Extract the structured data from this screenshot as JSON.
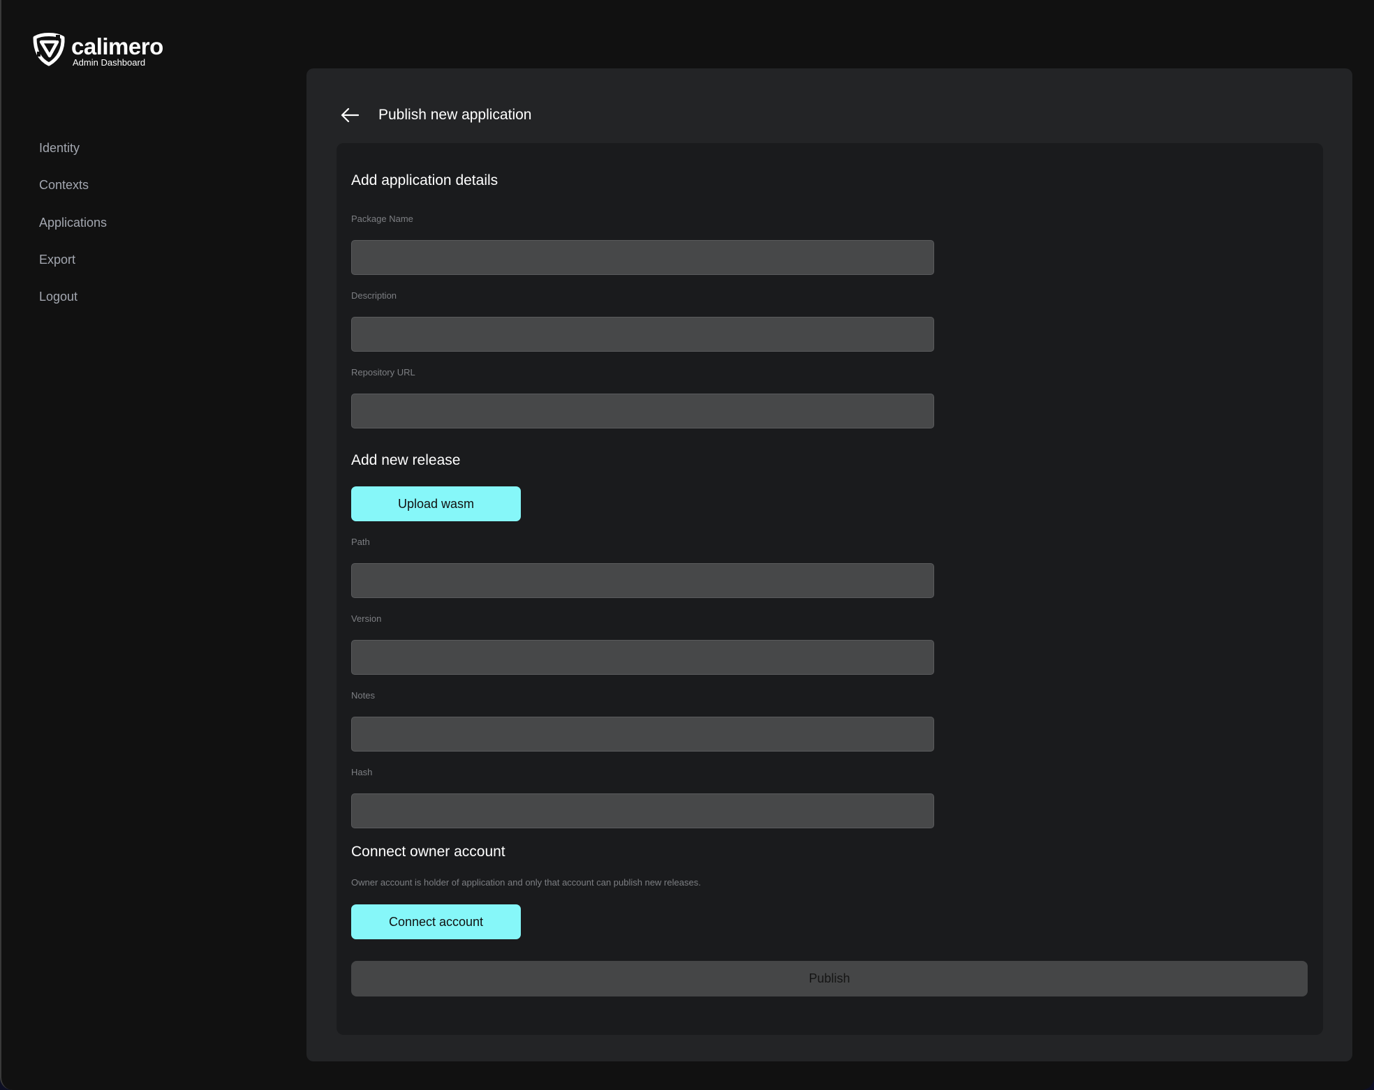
{
  "brand": {
    "name": "calimero",
    "subtitle": "Admin Dashboard",
    "logo_icon": "calimero-shield-logo"
  },
  "sidebar": {
    "items": [
      {
        "label": "Identity"
      },
      {
        "label": "Contexts"
      },
      {
        "label": "Applications"
      },
      {
        "label": "Export"
      },
      {
        "label": "Logout"
      }
    ]
  },
  "header": {
    "back_icon": "arrow-left-icon",
    "title": "Publish new application"
  },
  "form": {
    "details_section": {
      "title": "Add application details",
      "fields": [
        {
          "label": "Package Name",
          "value": "",
          "placeholder": ""
        },
        {
          "label": "Description",
          "value": "",
          "placeholder": ""
        },
        {
          "label": "Repository URL",
          "value": "",
          "placeholder": ""
        }
      ]
    },
    "release_section": {
      "title": "Add new release",
      "upload_button": "Upload wasm",
      "fields": [
        {
          "label": "Path",
          "value": "",
          "placeholder": ""
        },
        {
          "label": "Version",
          "value": "",
          "placeholder": ""
        },
        {
          "label": "Notes",
          "value": "",
          "placeholder": ""
        },
        {
          "label": "Hash",
          "value": "",
          "placeholder": ""
        }
      ]
    },
    "owner_section": {
      "title": "Connect owner account",
      "description": "Owner account is holder of application and only that account can publish new releases.",
      "connect_button": "Connect account"
    },
    "publish_button": "Publish"
  },
  "colors": {
    "accent": "#86f7f9",
    "page_bg": "#111111",
    "panel_bg": "#232426",
    "card_bg": "#1a1b1d",
    "input_bg": "#474849",
    "disabled_button_bg": "#454647"
  }
}
